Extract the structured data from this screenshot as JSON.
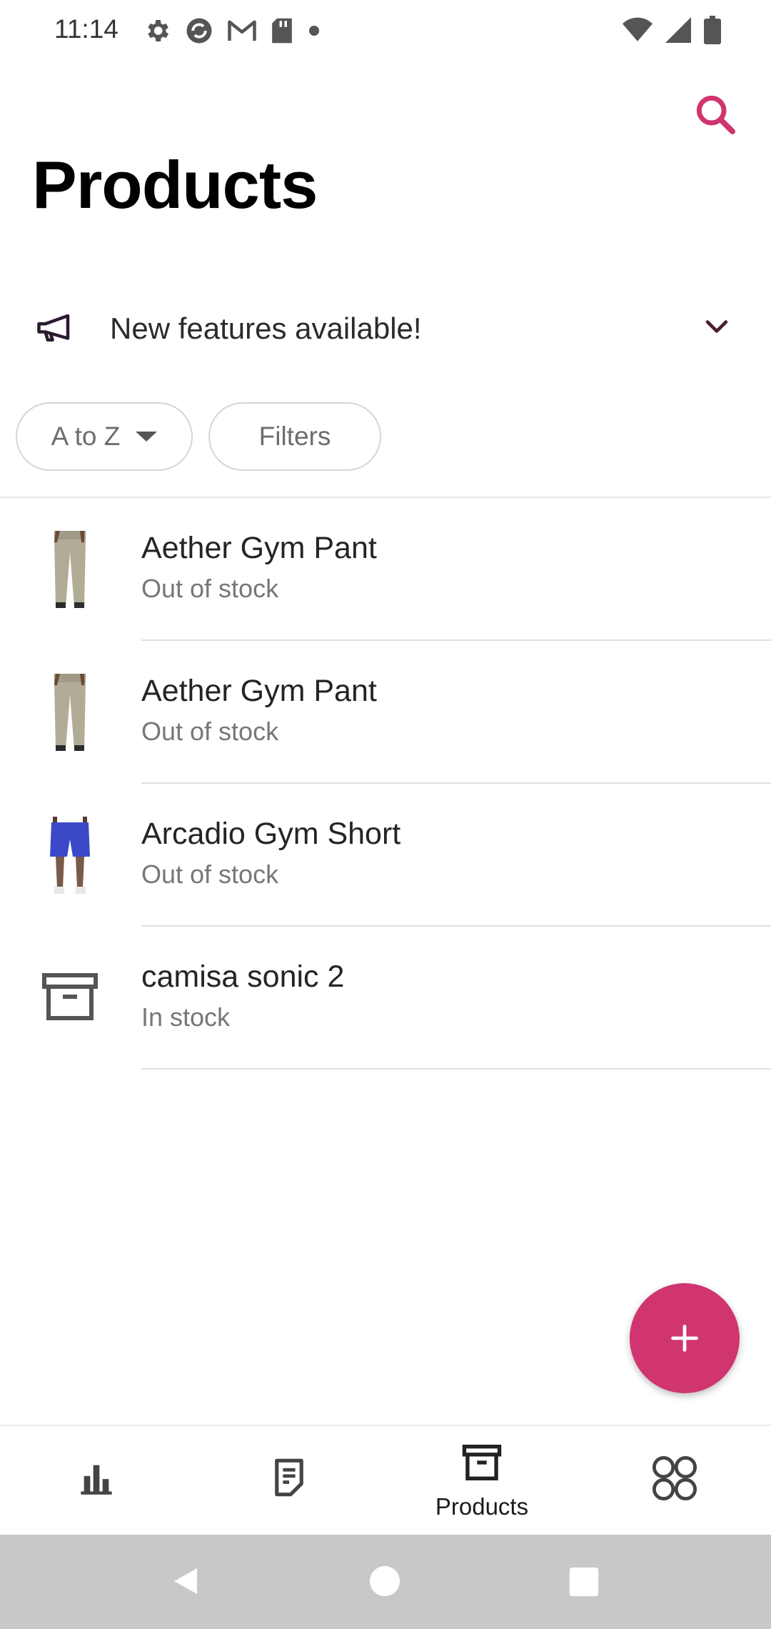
{
  "status_bar": {
    "time": "11:14",
    "icons_left": [
      "settings-icon",
      "sync-icon",
      "gmail-icon",
      "sd-card-icon",
      "dot-icon"
    ],
    "icons_right": [
      "wifi-icon",
      "signal-icon",
      "battery-icon"
    ]
  },
  "header": {
    "title": "Products",
    "search_icon": "search-icon"
  },
  "banner": {
    "text": "New features available!",
    "icon": "megaphone-icon",
    "expand_icon": "chevron-down-icon"
  },
  "chips": {
    "sort_label": "A to Z",
    "filters_label": "Filters"
  },
  "products": [
    {
      "name": "Aether Gym Pant",
      "stock": "Out of stock",
      "thumb": "pant"
    },
    {
      "name": "Aether Gym Pant",
      "stock": "Out of stock",
      "thumb": "pant"
    },
    {
      "name": "Arcadio Gym Short",
      "stock": "Out of stock",
      "thumb": "short"
    },
    {
      "name": "camisa sonic 2",
      "stock": "In stock",
      "thumb": "placeholder"
    }
  ],
  "fab": {
    "icon": "plus-icon"
  },
  "bottom_nav": {
    "items": [
      {
        "id": "dashboard",
        "icon": "bar-chart-icon",
        "label": ""
      },
      {
        "id": "orders",
        "icon": "orders-icon",
        "label": ""
      },
      {
        "id": "products",
        "icon": "archive-icon",
        "label": "Products"
      },
      {
        "id": "menu",
        "icon": "grid-icon",
        "label": ""
      }
    ]
  },
  "colors": {
    "accent": "#d0356f",
    "text_primary": "#242424",
    "text_secondary": "#777777",
    "system_nav_bg": "#c8c8c8"
  }
}
